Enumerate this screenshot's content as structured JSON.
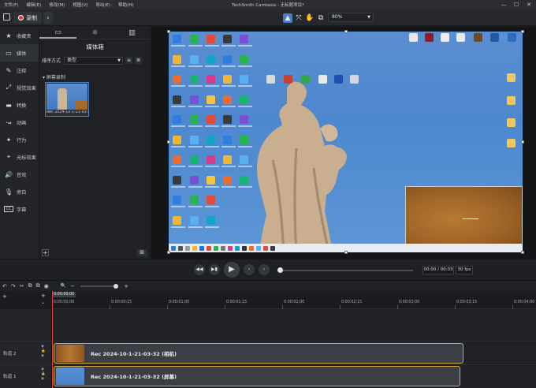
{
  "menu": {
    "items": [
      "文件(F)",
      "编辑(E)",
      "修改(M)",
      "视图(V)",
      "导出(E)",
      "帮助(H)"
    ]
  },
  "window_title": "TechSmith Camtasia - 无标题项目*",
  "window_controls": {
    "minimize": "—",
    "maximize": "☐",
    "close": "✕"
  },
  "toolbar": {
    "record_label": "录制",
    "forward_icon": "›",
    "zoom_value": "80%",
    "tool_icons": [
      "▲",
      "⤧",
      "✋",
      "⧉"
    ]
  },
  "sidebar": {
    "items": [
      {
        "icon": "★",
        "label": "收藏夹"
      },
      {
        "icon": "▭",
        "label": "媒体"
      },
      {
        "icon": "✎",
        "label": "注释"
      },
      {
        "icon": "⤢",
        "label": "视觉效果"
      },
      {
        "icon": "▬",
        "label": "转换"
      },
      {
        "icon": "↝",
        "label": "动画"
      },
      {
        "icon": "✦",
        "label": "行为"
      },
      {
        "icon": "⌖",
        "label": "光标效果"
      },
      {
        "icon": "🔊",
        "label": "音效"
      },
      {
        "icon": "🎙",
        "label": "旁白"
      },
      {
        "icon": "CC",
        "label": "字幕"
      }
    ]
  },
  "media_panel": {
    "tabs": [
      "▭",
      "⚛",
      "▥"
    ],
    "title": "媒体箱",
    "sort_label": "排序方式",
    "sort_value": "类型",
    "group_label": "▾ 屏幕录制",
    "clip_caption": "Rec 2024-10-1-21-03-32...",
    "add_icon": "+",
    "grid_icon": "⊞"
  },
  "player": {
    "time": "00:00 / 00:03",
    "fps": "30 fps",
    "buttons": [
      "◀◀",
      "▶▮",
      "▶",
      "‹",
      "›"
    ]
  },
  "timeline": {
    "toolbar_icons": [
      "↶",
      "↷",
      "✂",
      "⧉",
      "⧉",
      "◉",
      "🔍",
      "−",
      "+"
    ],
    "playhead": "0:00:00;00",
    "ticks": [
      "0:00:00;00",
      "0:00:00;15",
      "0:00:01;00",
      "0:00:01;15",
      "0:00:02;00",
      "0:00:02;15",
      "0:00:03;00",
      "0:00:03;15",
      "0:00:04;00"
    ],
    "tracks": [
      {
        "name": "轨道 2",
        "clip_label": "Rec 2024-10-1-21-03-32 (相机)",
        "thumb_color": "#a0652a"
      },
      {
        "name": "轨道 1",
        "clip_label": "Rec 2024-10-1-21-03-32 (屏幕)",
        "thumb_color": "#4a85cc"
      }
    ]
  },
  "colors": {
    "accent": "#4b7ac7",
    "clip_border": "#d5b046",
    "playhead": "#e04848",
    "record": "#e3342f"
  }
}
